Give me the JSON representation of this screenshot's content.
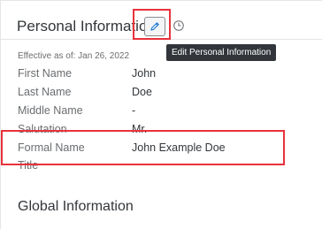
{
  "header": {
    "title": "Personal Information",
    "edit_tooltip": "Edit Personal Information"
  },
  "effective_date": "Effective as of: Jan 26, 2022",
  "fields": [
    {
      "label": "First Name",
      "value": "John"
    },
    {
      "label": "Last Name",
      "value": "Doe"
    },
    {
      "label": "Middle Name",
      "value": "-"
    },
    {
      "label": "Salutation",
      "value": "Mr."
    },
    {
      "label": "Formal Name",
      "value": "John Example Doe"
    },
    {
      "label": "Title",
      "value": ""
    }
  ],
  "global_section": {
    "title": "Global Information"
  },
  "icons": {
    "edit": "pencil-icon",
    "history": "clock-icon"
  },
  "colors": {
    "highlight": "#e8323c",
    "tooltip_bg": "#32363a",
    "label": "#6a6d70",
    "text": "#32363a"
  }
}
